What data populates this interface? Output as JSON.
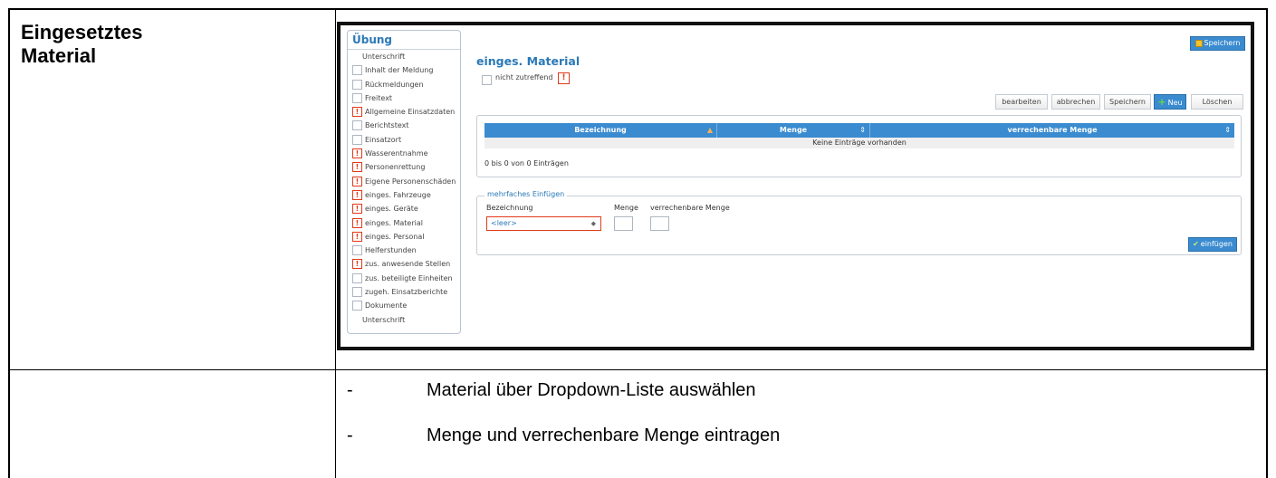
{
  "document": {
    "section_title": "Eingesetztes Material",
    "bullets": [
      "Material über Dropdown-Liste auswählen",
      "Menge und verrechenbare Menge eintragen"
    ],
    "bullet_marker": "-"
  },
  "app": {
    "sidebar": {
      "title": "Übung",
      "items": [
        {
          "label": "Unterschrift",
          "state": "none"
        },
        {
          "label": "Inhalt der Meldung",
          "state": "checkbox"
        },
        {
          "label": "Rückmeldungen",
          "state": "checkbox"
        },
        {
          "label": "Freitext",
          "state": "checkbox"
        },
        {
          "label": "Allgemeine Einsatzdaten",
          "state": "warning"
        },
        {
          "label": "Berichtstext",
          "state": "checkbox"
        },
        {
          "label": "Einsatzort",
          "state": "checkbox"
        },
        {
          "label": "Wasserentnahme",
          "state": "warning"
        },
        {
          "label": "Personenrettung",
          "state": "warning"
        },
        {
          "label": "Eigene Personenschäden",
          "state": "warning"
        },
        {
          "label": "einges. Fahrzeuge",
          "state": "warning"
        },
        {
          "label": "einges. Geräte",
          "state": "warning"
        },
        {
          "label": "einges. Material",
          "state": "warning"
        },
        {
          "label": "einges. Personal",
          "state": "warning"
        },
        {
          "label": "Helferstunden",
          "state": "checkbox"
        },
        {
          "label": "zus. anwesende Stellen",
          "state": "warning"
        },
        {
          "label": "zus. beteiligte Einheiten",
          "state": "checkbox"
        },
        {
          "label": "zugeh. Einsatzberichte",
          "state": "checkbox"
        },
        {
          "label": "Dokumente",
          "state": "checkbox"
        },
        {
          "label": "Unterschrift",
          "state": "none"
        }
      ]
    },
    "top_save_label": "Speichern",
    "page_heading": "einges. Material",
    "not_applicable_label": "nicht zutreffend",
    "warning_glyph": "!",
    "toolbar": {
      "edit": "bearbeiten",
      "cancel": "abbrechen",
      "save": "Speichern",
      "new": "Neu",
      "delete": "Löschen"
    },
    "grid": {
      "columns": [
        "Bezeichnung",
        "Menge",
        "verrechenbare Menge"
      ],
      "empty_text": "Keine Einträge vorhanden",
      "info_text": "0 bis 0 von 0 Einträgen"
    },
    "multi_insert": {
      "legend": "mehrfaches Einfügen",
      "label_name": "Bezeichnung",
      "label_qty": "Menge",
      "label_billable": "verrechenbare Menge",
      "select_value": "<leer>",
      "button": "einfügen"
    },
    "colors": {
      "accent": "#3a8bd0",
      "heading": "#2a79b8",
      "warning": "#e23a1c"
    }
  }
}
